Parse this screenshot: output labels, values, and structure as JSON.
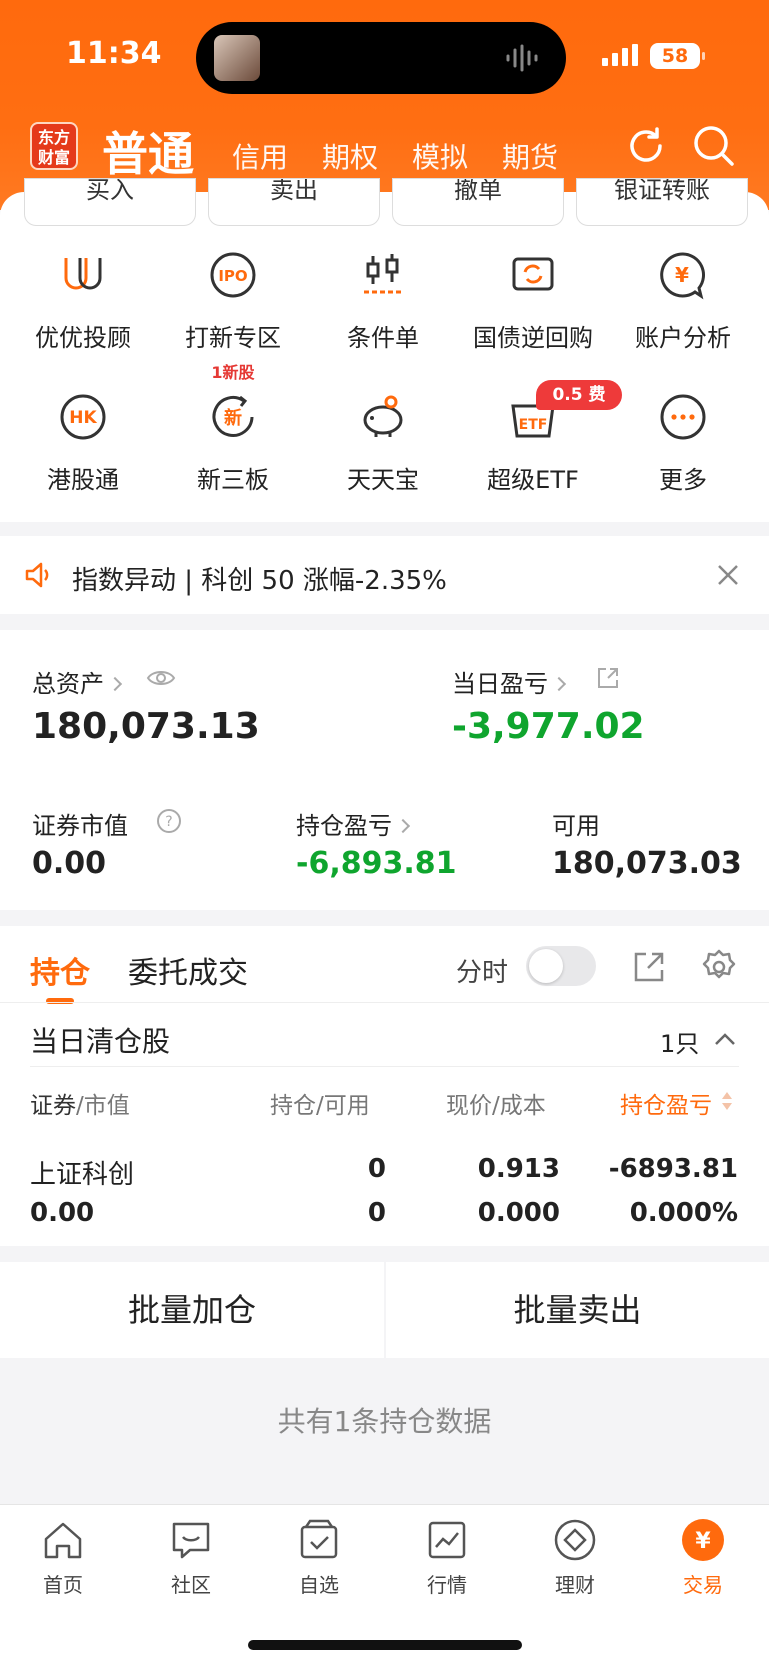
{
  "status": {
    "time": "11:34",
    "battery": "58"
  },
  "header": {
    "logo": "东方财富",
    "main_tab": "普通",
    "tabs": [
      "信用",
      "期权",
      "模拟",
      "期货"
    ]
  },
  "trade_row": [
    "买入",
    "卖出",
    "撤单",
    "银证转账"
  ],
  "grid": [
    {
      "label": "优优投顾",
      "icon": "uu-icon"
    },
    {
      "label": "打新专区",
      "icon": "ipo-icon",
      "sub": "1新股"
    },
    {
      "label": "条件单",
      "icon": "candle-icon"
    },
    {
      "label": "国债逆回购",
      "icon": "repo-icon"
    },
    {
      "label": "账户分析",
      "icon": "yen-chat-icon"
    },
    {
      "label": "港股通",
      "icon": "hk-icon"
    },
    {
      "label": "新三板",
      "icon": "new-board-icon"
    },
    {
      "label": "天天宝",
      "icon": "piggy-icon"
    },
    {
      "label": "超级ETF",
      "icon": "etf-icon"
    },
    {
      "label": "更多",
      "icon": "more-icon"
    }
  ],
  "etf_badge": "0.5 费",
  "notice": "指数异动 | 科创 50 涨幅-2.35%",
  "asset": {
    "total_label": "总资产",
    "total_value": "180,073.13",
    "daily_label": "当日盈亏",
    "daily_value": "-3,977.02",
    "market_label": "证券市值",
    "market_value": "0.00",
    "hold_label": "持仓盈亏",
    "hold_value": "-6,893.81",
    "avail_label": "可用",
    "avail_value": "180,073.03"
  },
  "holdings": {
    "tab_active": "持仓",
    "tab_other": "委托成交",
    "intraday_label": "分时",
    "section_title": "当日清仓股",
    "count": "1只",
    "cols": {
      "c1a": "证券",
      "c1b": "/市值",
      "c2a": "持仓",
      "c2b": "/可用",
      "c3a": "现价",
      "c3b": "/成本",
      "c4": "持仓盈亏"
    },
    "rows": [
      {
        "name": "上证科创",
        "mv": "0.00",
        "pos": "0",
        "avail": "0",
        "price": "0.913",
        "cost": "0.000",
        "pl": "-6893.81",
        "plpct": "0.000%"
      }
    ]
  },
  "batch": {
    "add": "批量加仓",
    "sell": "批量卖出"
  },
  "summary": "共有1条持仓数据",
  "bottom_nav": [
    "首页",
    "社区",
    "自选",
    "行情",
    "理财",
    "交易"
  ],
  "colors": {
    "brand": "#ff6a0d",
    "down": "#0fa52e",
    "badge": "#ee3a3a"
  }
}
